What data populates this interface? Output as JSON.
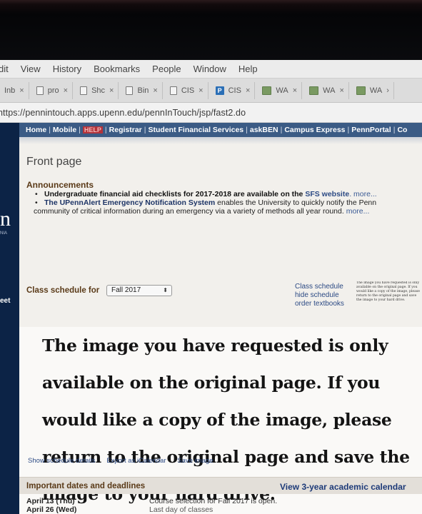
{
  "menubar": {
    "items": [
      "dit",
      "View",
      "History",
      "Bookmarks",
      "People",
      "Window",
      "Help"
    ]
  },
  "tabs": [
    {
      "label": "Inb",
      "icon": "mail-icon"
    },
    {
      "label": "pro",
      "icon": "page-icon"
    },
    {
      "label": "Shc",
      "icon": "page-icon"
    },
    {
      "label": "Bin",
      "icon": "page-icon"
    },
    {
      "label": "CIS",
      "icon": "page-icon"
    },
    {
      "label": "CIS",
      "icon": "p-icon"
    },
    {
      "label": "WA",
      "icon": "wa-icon"
    },
    {
      "label": "WA",
      "icon": "wa-icon"
    },
    {
      "label": "WA",
      "icon": "wa-icon"
    }
  ],
  "address": {
    "url": "https://pennintouch.apps.upenn.edu/pennInTouch/jsp/fast2.do"
  },
  "sidebar": {
    "letter": "n",
    "small": "NIA",
    "label": "eet"
  },
  "nav": {
    "home": "Home",
    "mobile": "Mobile",
    "help": "HELP",
    "registrar": "Registrar",
    "sfs": "Student Financial Services",
    "askben": "askBEN",
    "campus": "Campus Express",
    "portal": "PennPortal",
    "co": "Co"
  },
  "page": {
    "title": "Front page"
  },
  "announcements": {
    "heading": "Announcements",
    "item1_bold": "Undergraduate financial aid checklists for 2017-2018 are available on the ",
    "item1_link": "SFS website",
    "item1_more": ". more...",
    "item2_bold": "The UPennAlert Emergency Notification System",
    "item2_text": " enables the University to quickly notify the Penn",
    "item2_line2": "community of critical information during an emergency via a variety of methods all year round. ",
    "item2_more": "more..."
  },
  "schedule": {
    "label": "Class schedule for",
    "term": "Fall 2017",
    "link1": "Class schedule",
    "link2": "hide schedule",
    "link3": "order textbooks",
    "tiny_note": "The image you have requested is only available on the original page. If you would like a copy of the image, please return to the original page and save the image to your hard drive."
  },
  "placeholder": {
    "text": "The image you have requested is only available on the original page. If you would like a copy of the image, please return to the original page and save the image to your hard drive."
  },
  "footer_links": {
    "details": "Show schedule details",
    "export": "Export as iCalendar",
    "save": "Save image"
  },
  "dates": {
    "heading": "Important dates and deadlines",
    "calendar_link": "View 3-year academic calendar",
    "row1_date": "April 13 (Thu)",
    "row1_text": "Course selection for Fall 2017 is open.",
    "row2_date": "April 26 (Wed)",
    "row2_text": "Last day of classes"
  }
}
